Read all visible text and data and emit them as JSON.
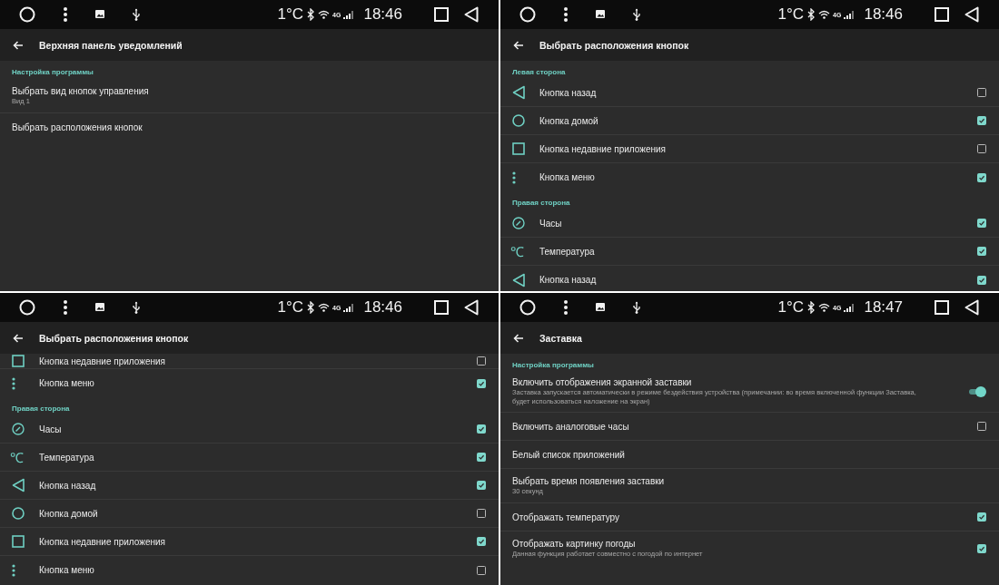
{
  "panels": [
    {
      "status_bar": {
        "temperature": "1°C",
        "network": "4G",
        "time": "18:46"
      },
      "toolbar": {
        "title": "Верхняя панель уведомлений"
      },
      "sections": [
        {
          "header": "Настройка программы",
          "items": [
            {
              "kind": "text",
              "title": "Выбрать вид кнопок управления",
              "summary": "Вид 1"
            },
            {
              "kind": "text",
              "title": "Выбрать расположения кнопок"
            }
          ]
        }
      ]
    },
    {
      "status_bar": {
        "temperature": "1°C",
        "network": "4G",
        "time": "18:46"
      },
      "toolbar": {
        "title": "Выбрать расположения кнопок"
      },
      "sections": [
        {
          "header": "Левая сторона",
          "items": [
            {
              "kind": "back",
              "title": "Кнопка назад",
              "checked": false
            },
            {
              "kind": "home",
              "title": "Кнопка домой",
              "checked": true
            },
            {
              "kind": "recents",
              "title": "Кнопка недавние приложения",
              "checked": false
            },
            {
              "kind": "menu",
              "title": "Кнопка меню",
              "checked": true
            }
          ]
        },
        {
          "header": "Правая сторона",
          "items": [
            {
              "kind": "clock",
              "title": "Часы",
              "checked": true
            },
            {
              "kind": "celsius",
              "glyph": "℃",
              "title": "Температура",
              "checked": true
            },
            {
              "kind": "back",
              "title": "Кнопка назад",
              "checked": true
            }
          ]
        }
      ]
    },
    {
      "status_bar": {
        "temperature": "1°C",
        "network": "4G",
        "time": "18:46"
      },
      "toolbar": {
        "title": "Выбрать расположения кнопок"
      },
      "sections": [
        {
          "items": [
            {
              "kind": "recents",
              "title": "Кнопка недавние приложения",
              "checked": false,
              "partial": true
            },
            {
              "kind": "menu",
              "title": "Кнопка меню",
              "checked": true
            }
          ]
        },
        {
          "header": "Правая сторона",
          "items": [
            {
              "kind": "clock",
              "title": "Часы",
              "checked": true
            },
            {
              "kind": "celsius",
              "glyph": "℃",
              "title": "Температура",
              "checked": true
            },
            {
              "kind": "back",
              "title": "Кнопка назад",
              "checked": true
            },
            {
              "kind": "home",
              "title": "Кнопка домой",
              "checked": false
            },
            {
              "kind": "recents",
              "title": "Кнопка недавние приложения",
              "checked": true
            },
            {
              "kind": "menu",
              "title": "Кнопка меню",
              "checked": false
            }
          ]
        }
      ]
    },
    {
      "status_bar": {
        "temperature": "1°C",
        "network": "4G",
        "time": "18:47"
      },
      "toolbar": {
        "title": "Заставка"
      },
      "sections": [
        {
          "header": "Настройка программы",
          "items": [
            {
              "kind": "switch",
              "title": "Включить отображения экранной заставки",
              "summary": "Заставка запускается автоматически в режиме бездействия устройства (примечании: во время включенной функции Заставка, будет использоваться наложение на экран)",
              "on": true
            },
            {
              "kind": "checkbox",
              "title": "Включить аналоговые часы",
              "checked": false
            },
            {
              "kind": "text",
              "title": "Белый список приложений"
            },
            {
              "kind": "text",
              "title": "Выбрать время появления заставки",
              "summary": "30 секунд"
            },
            {
              "kind": "checkbox",
              "title": "Отображать температуру",
              "checked": true
            },
            {
              "kind": "checkbox",
              "title": "Отображать картинку погоды",
              "summary": "Данная функция работает совместно с погодой по интернет",
              "checked": true
            }
          ]
        }
      ]
    }
  ]
}
